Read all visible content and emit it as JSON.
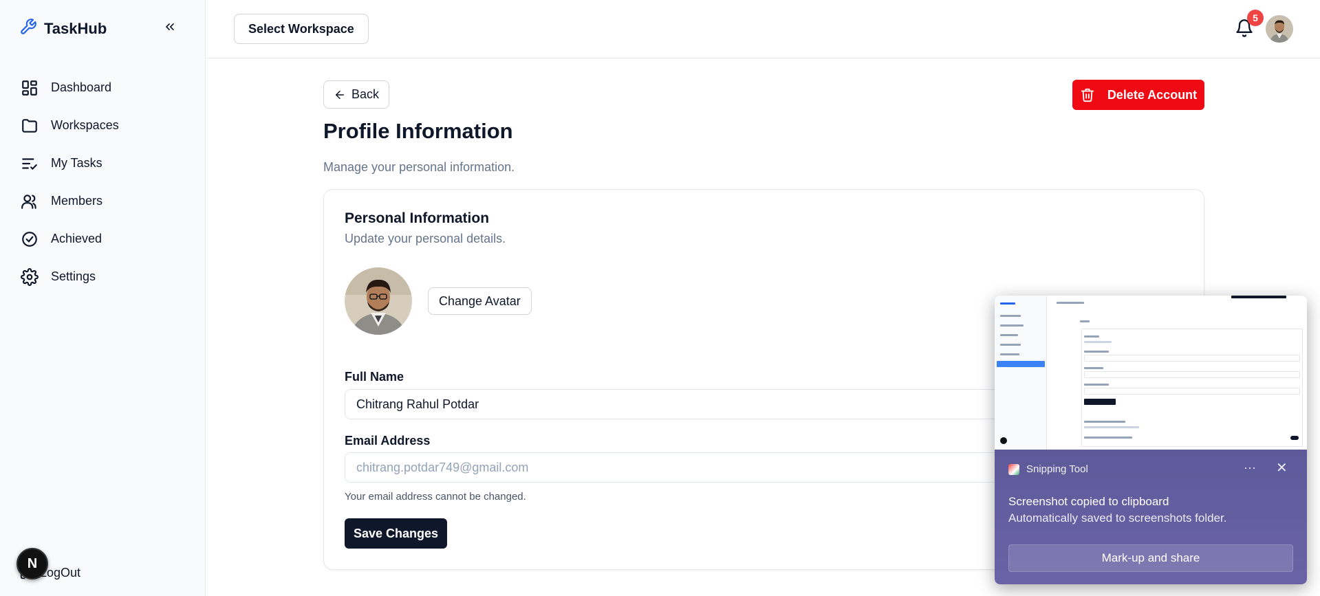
{
  "app": {
    "name": "TaskHub"
  },
  "sidebar": {
    "items": [
      {
        "label": "Dashboard",
        "icon": "dashboard-icon"
      },
      {
        "label": "Workspaces",
        "icon": "folder-icon"
      },
      {
        "label": "My Tasks",
        "icon": "list-check-icon"
      },
      {
        "label": "Members",
        "icon": "users-icon"
      },
      {
        "label": "Achieved",
        "icon": "check-circle-icon"
      },
      {
        "label": "Settings",
        "icon": "gear-icon"
      }
    ],
    "logout": "LogOut",
    "dev_badge": "N"
  },
  "header": {
    "workspace_button": "Select Workspace",
    "notification_count": "5"
  },
  "page": {
    "back": "Back",
    "delete": "Delete Account",
    "title": "Profile Information",
    "subtitle": "Manage your personal information."
  },
  "card": {
    "title": "Personal Information",
    "subtitle": "Update your personal details.",
    "change_avatar": "Change Avatar",
    "full_name_label": "Full Name",
    "full_name_value": "Chitrang Rahul Potdar",
    "email_label": "Email Address",
    "email_value": "chitrang.potdar749@gmail.com",
    "email_hint": "Your email address cannot be changed.",
    "save": "Save Changes"
  },
  "toast": {
    "app": "Snipping Tool",
    "more": "···",
    "close": "✕",
    "message": "Screenshot copied to clipboard",
    "detail": "Automatically saved to screenshots folder.",
    "action": "Mark-up and share"
  },
  "colors": {
    "accent": "#2563eb",
    "danger": "#ef0a14",
    "primary": "#0f172a",
    "toast": "#5d5a9a"
  }
}
